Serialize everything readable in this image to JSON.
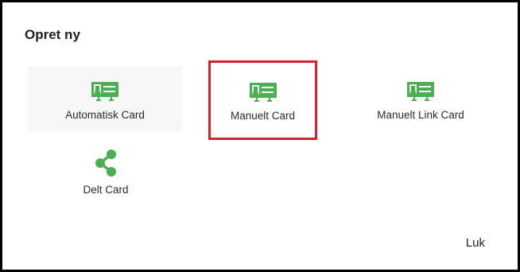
{
  "dialog": {
    "title": "Opret ny",
    "close_label": "Luk"
  },
  "options": [
    {
      "label": "Automatisk Card",
      "icon": "card-icon"
    },
    {
      "label": "Manuelt Card",
      "icon": "card-icon",
      "highlighted": true
    },
    {
      "label": "Manuelt Link Card",
      "icon": "card-icon"
    },
    {
      "label": "Delt Card",
      "icon": "share-icon"
    }
  ],
  "colors": {
    "icon_green": "#4caf50",
    "highlight_red": "#d1252e",
    "hover_bg": "#f7f7f7"
  }
}
